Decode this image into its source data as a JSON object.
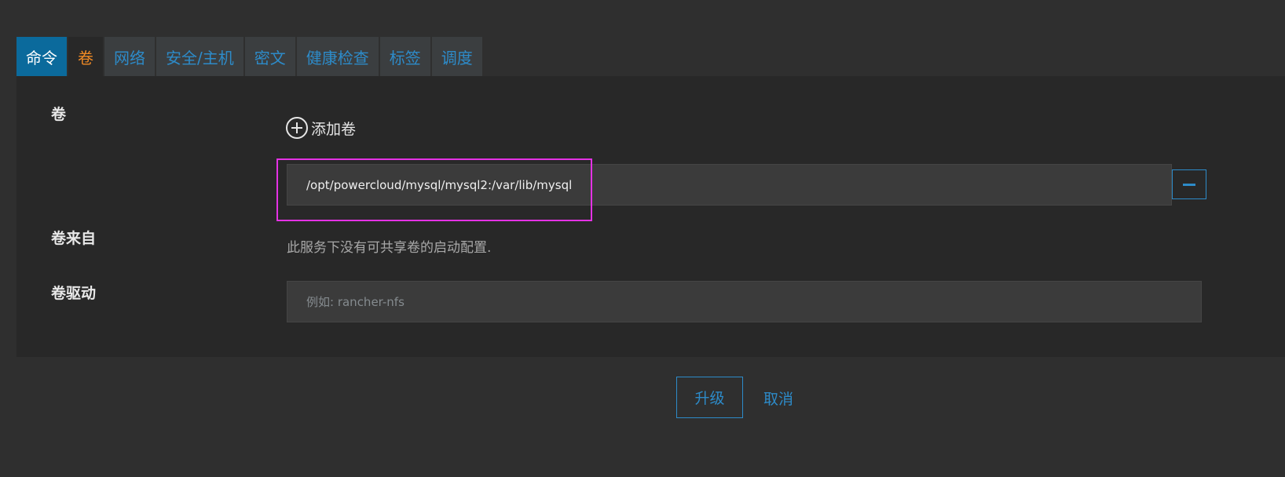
{
  "tabs": [
    {
      "label": "命令",
      "state": "active"
    },
    {
      "label": "卷",
      "state": "current"
    },
    {
      "label": "网络",
      "state": "normal"
    },
    {
      "label": "安全/主机",
      "state": "normal"
    },
    {
      "label": "密文",
      "state": "normal"
    },
    {
      "label": "健康检查",
      "state": "normal"
    },
    {
      "label": "标签",
      "state": "normal"
    },
    {
      "label": "调度",
      "state": "normal"
    }
  ],
  "volumes": {
    "label": "卷",
    "add_label": "添加卷",
    "entries": [
      {
        "value": "/opt/powercloud/mysql/mysql2:/var/lib/mysql"
      }
    ]
  },
  "volumes_from": {
    "label": "卷来自",
    "message": "此服务下没有可共享卷的启动配置."
  },
  "volume_driver": {
    "label": "卷驱动",
    "value": "",
    "placeholder": "例如: rancher-nfs"
  },
  "footer": {
    "upgrade_label": "升级",
    "cancel_label": "取消"
  },
  "colors": {
    "accent": "#2d8bc9",
    "active_tab": "#0b6a9c",
    "current_tab_text": "#f08a24",
    "highlight": "#e432e4"
  }
}
